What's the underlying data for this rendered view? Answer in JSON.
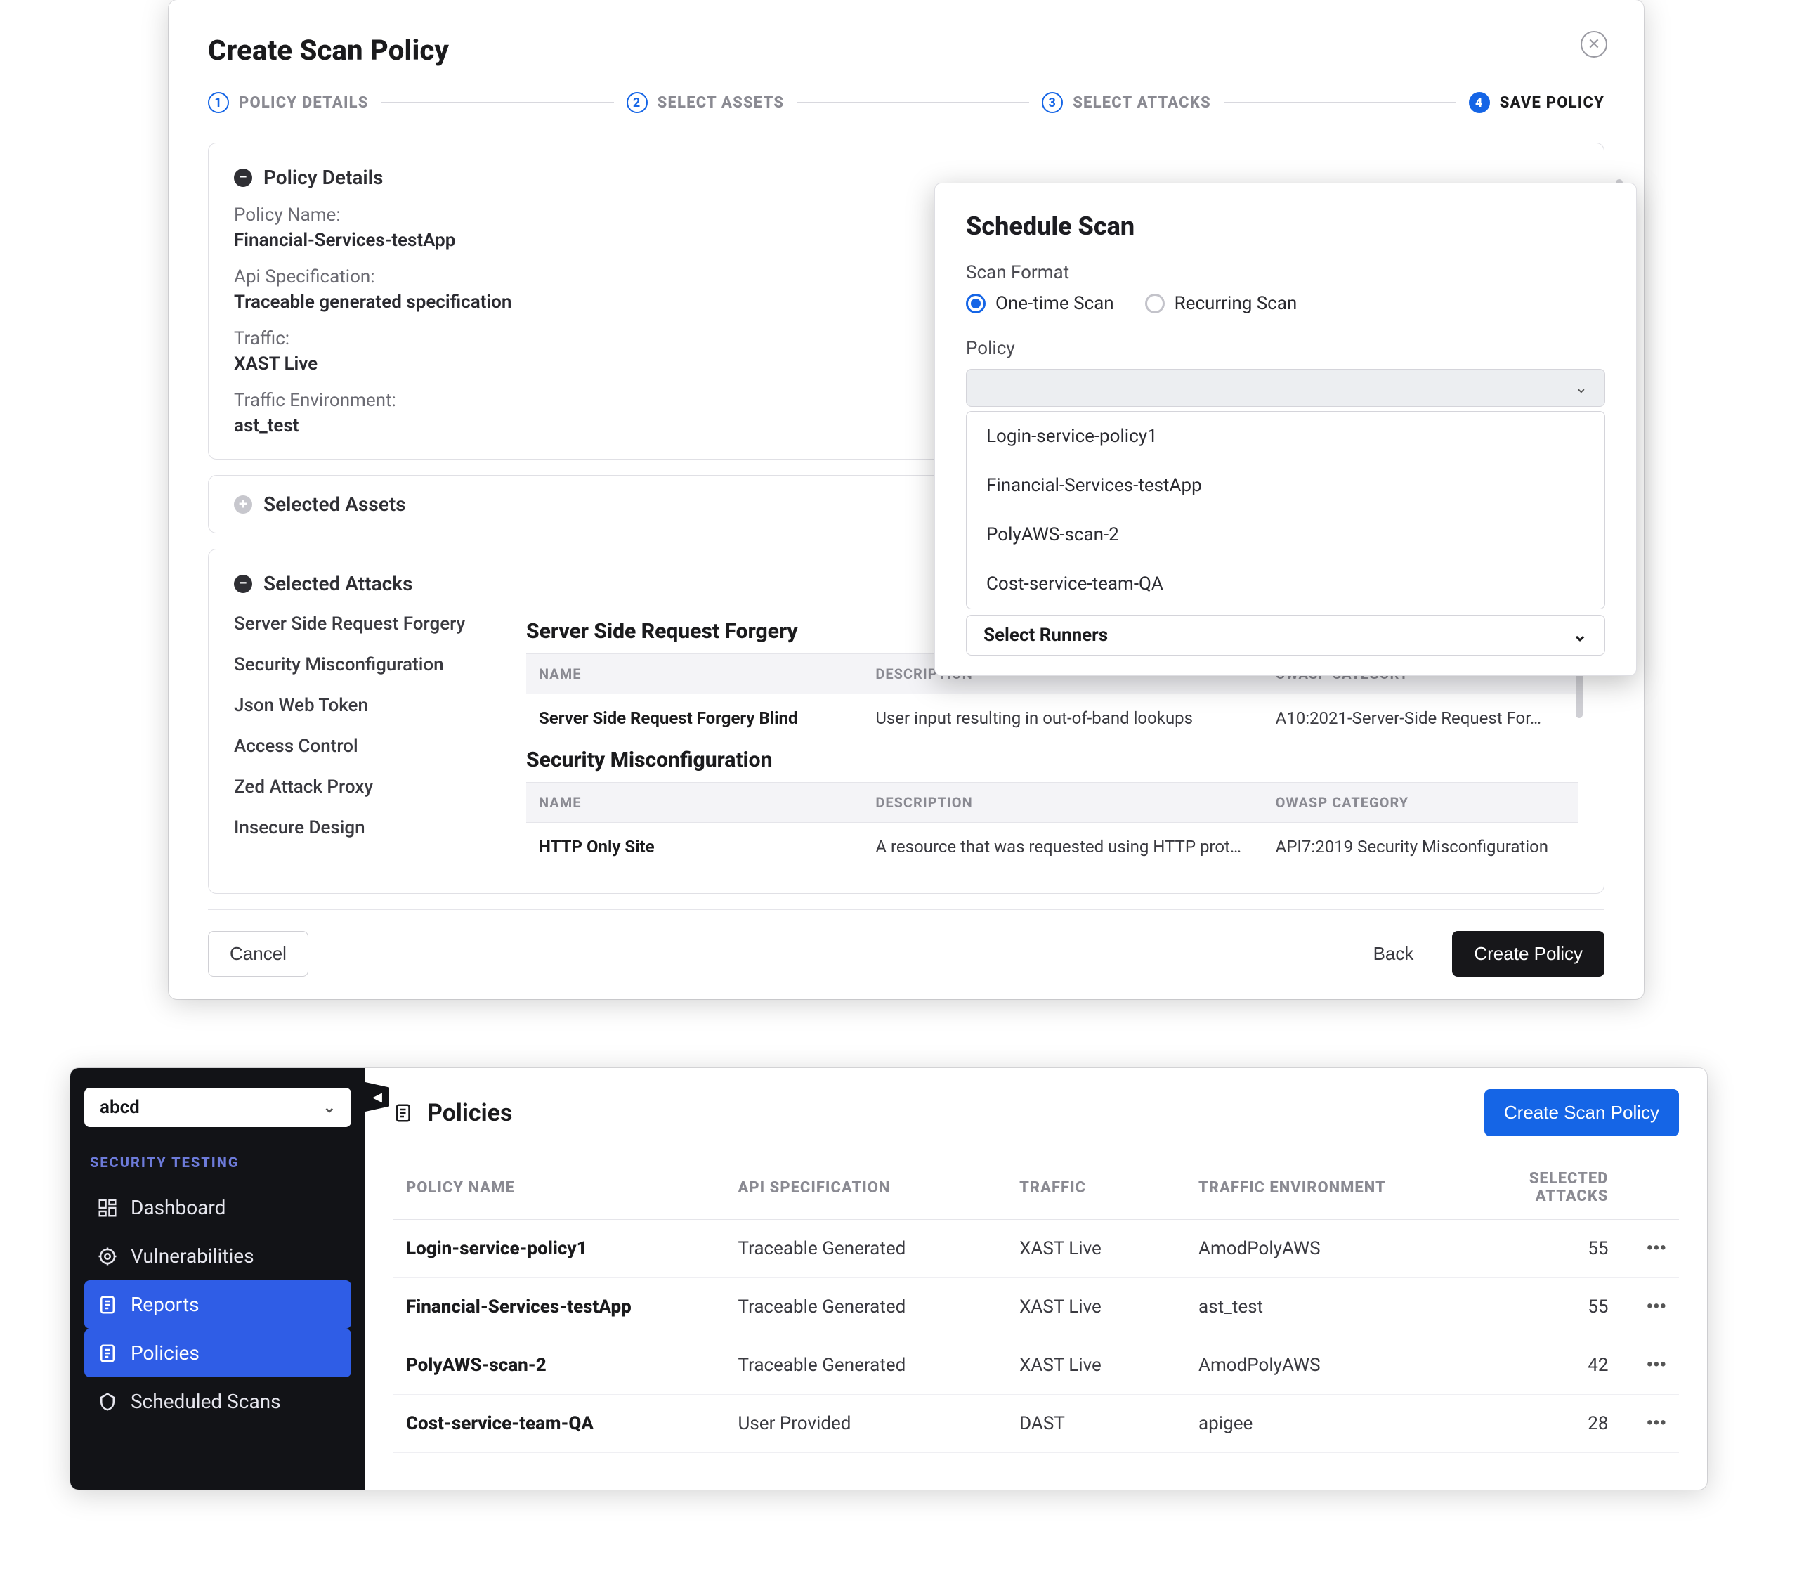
{
  "modal": {
    "title": "Create Scan Policy",
    "stepper": {
      "steps": [
        {
          "num": "1",
          "label": "POLICY DETAILS"
        },
        {
          "num": "2",
          "label": "SELECT ASSETS"
        },
        {
          "num": "3",
          "label": "SELECT ATTACKS"
        },
        {
          "num": "4",
          "label": "SAVE POLICY"
        }
      ],
      "active_index": 3
    },
    "policy_details": {
      "panel_title": "Policy Details",
      "fields": {
        "policy_name_label": "Policy Name:",
        "policy_name_value": "Financial-Services-testApp",
        "api_spec_label": "Api Specification:",
        "api_spec_value": "Traceable generated specification",
        "traffic_label": "Traffic:",
        "traffic_value": "XAST Live",
        "env_label": "Traffic Environment:",
        "env_value": "ast_test"
      }
    },
    "selected_assets": {
      "panel_title": "Selected Assets"
    },
    "selected_attacks": {
      "panel_title": "Selected Attacks",
      "nav": [
        "Server Side Request Forgery",
        "Security Misconfiguration",
        "Json Web Token",
        "Access Control",
        "Zed Attack Proxy",
        "Insecure Design"
      ],
      "table_headers": {
        "name": "NAME",
        "desc": "DESCRIPTION",
        "owasp": "OWASP CATEGORY"
      },
      "groups": [
        {
          "title": "Server Side Request Forgery",
          "rows": [
            {
              "name": "Server Side Request Forgery Blind",
              "desc": "User input resulting in out-of-band lookups",
              "owasp": "A10:2021-Server-Side Request For…"
            }
          ]
        },
        {
          "title": "Security Misconfiguration",
          "rows": [
            {
              "name": "HTTP Only Site",
              "desc": "A resource that was requested using HTTP prot…",
              "owasp": "API7:2019 Security Misconfiguration"
            }
          ]
        }
      ]
    },
    "footer": {
      "cancel": "Cancel",
      "back": "Back",
      "create": "Create Policy"
    }
  },
  "schedule": {
    "title": "Schedule Scan",
    "scan_format_label": "Scan Format",
    "options": {
      "one_time": "One-time Scan",
      "recurring": "Recurring Scan"
    },
    "policy_label": "Policy",
    "policy_options": [
      "Login-service-policy1",
      "Financial-Services-testApp",
      "PolyAWS-scan-2",
      "Cost-service-team-QA"
    ],
    "runners_label": "Select Runners"
  },
  "app": {
    "env_value": "abcd",
    "section_label": "SECURITY TESTING",
    "nav_items": [
      {
        "key": "dashboard",
        "label": "Dashboard"
      },
      {
        "key": "vulnerabilities",
        "label": "Vulnerabilities"
      },
      {
        "key": "reports",
        "label": "Reports"
      },
      {
        "key": "policies",
        "label": "Policies"
      },
      {
        "key": "scheduled-scans",
        "label": "Scheduled Scans"
      }
    ],
    "active_nav": "policies",
    "page_title": "Policies",
    "create_button": "Create Scan Policy",
    "table": {
      "headers": {
        "policy_name": "POLICY NAME",
        "api_spec": "API SPECIFICATION",
        "traffic": "TRAFFIC",
        "env": "TRAFFIC ENVIRONMENT",
        "attacks": "SELECTED ATTACKS"
      },
      "rows": [
        {
          "name": "Login-service-policy1",
          "spec": "Traceable Generated",
          "traffic": "XAST Live",
          "env": "AmodPolyAWS",
          "attacks": "55"
        },
        {
          "name": "Financial-Services-testApp",
          "spec": "Traceable Generated",
          "traffic": "XAST Live",
          "env": "ast_test",
          "attacks": "55"
        },
        {
          "name": "PolyAWS-scan-2",
          "spec": "Traceable Generated",
          "traffic": "XAST Live",
          "env": "AmodPolyAWS",
          "attacks": "42"
        },
        {
          "name": "Cost-service-team-QA",
          "spec": "User Provided",
          "traffic": "DAST",
          "env": "apigee",
          "attacks": "28"
        }
      ]
    }
  }
}
